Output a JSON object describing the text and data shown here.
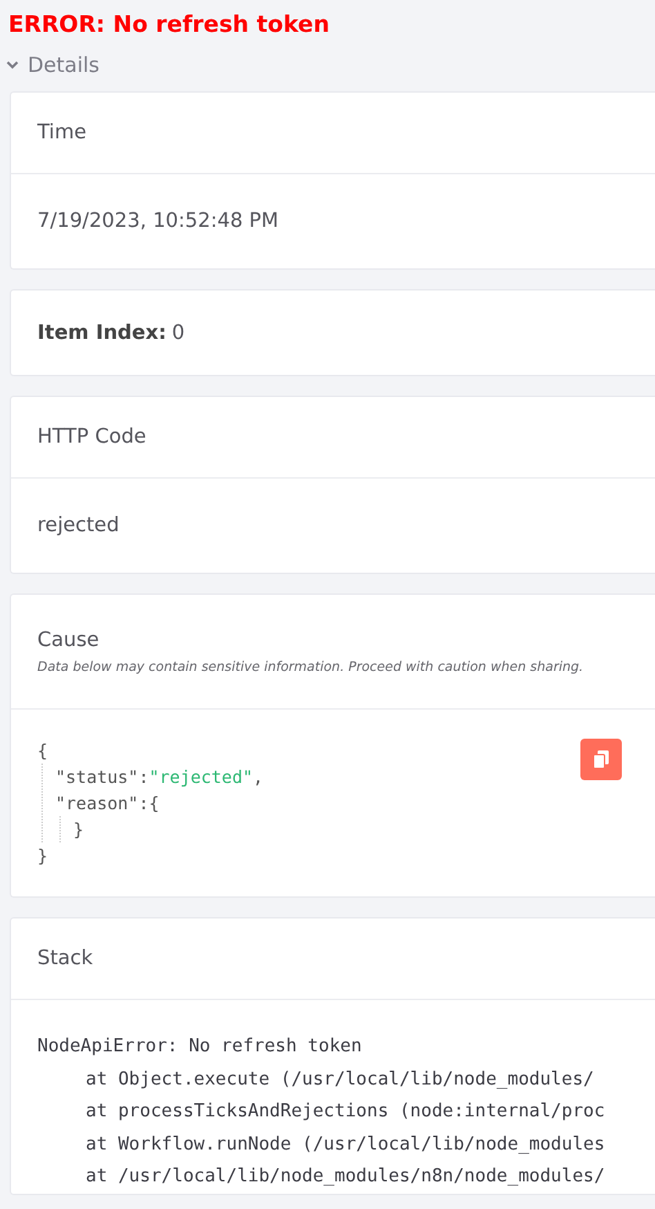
{
  "error_title": "ERROR: No refresh token",
  "details": {
    "label": "Details",
    "expanded": true
  },
  "cards": [
    {
      "kind": "header_value",
      "title": "Time",
      "value": "7/19/2023, 10:52:48 PM"
    },
    {
      "kind": "inline",
      "label": "Item Index:",
      "value": "0"
    },
    {
      "kind": "header_value",
      "title": "HTTP Code",
      "value": "rejected"
    },
    {
      "kind": "cause",
      "title": "Cause",
      "note": "Data below may contain sensitive information. Proceed with caution when sharing.",
      "code": {
        "open": "{",
        "children": [
          {
            "key": "\"status\"",
            "colon": ":",
            "value": "\"rejected\"",
            "comma": ","
          },
          {
            "key": "\"reason\"",
            "colon": ":",
            "open": "{",
            "close": "}"
          }
        ],
        "close": "}"
      }
    },
    {
      "kind": "stack",
      "title": "Stack",
      "lines": [
        {
          "text": "NodeApiError: No refresh token",
          "children": [
            {
              "text": "at Object.execute (/usr/local/lib/node_modules/"
            },
            {
              "text": "at processTicksAndRejections (node:internal/proc"
            },
            {
              "text": "at Workflow.runNode (/usr/local/lib/node_modules"
            },
            {
              "text": "at /usr/local/lib/node_modules/n8n/node_modules/"
            }
          ]
        }
      ]
    }
  ]
}
